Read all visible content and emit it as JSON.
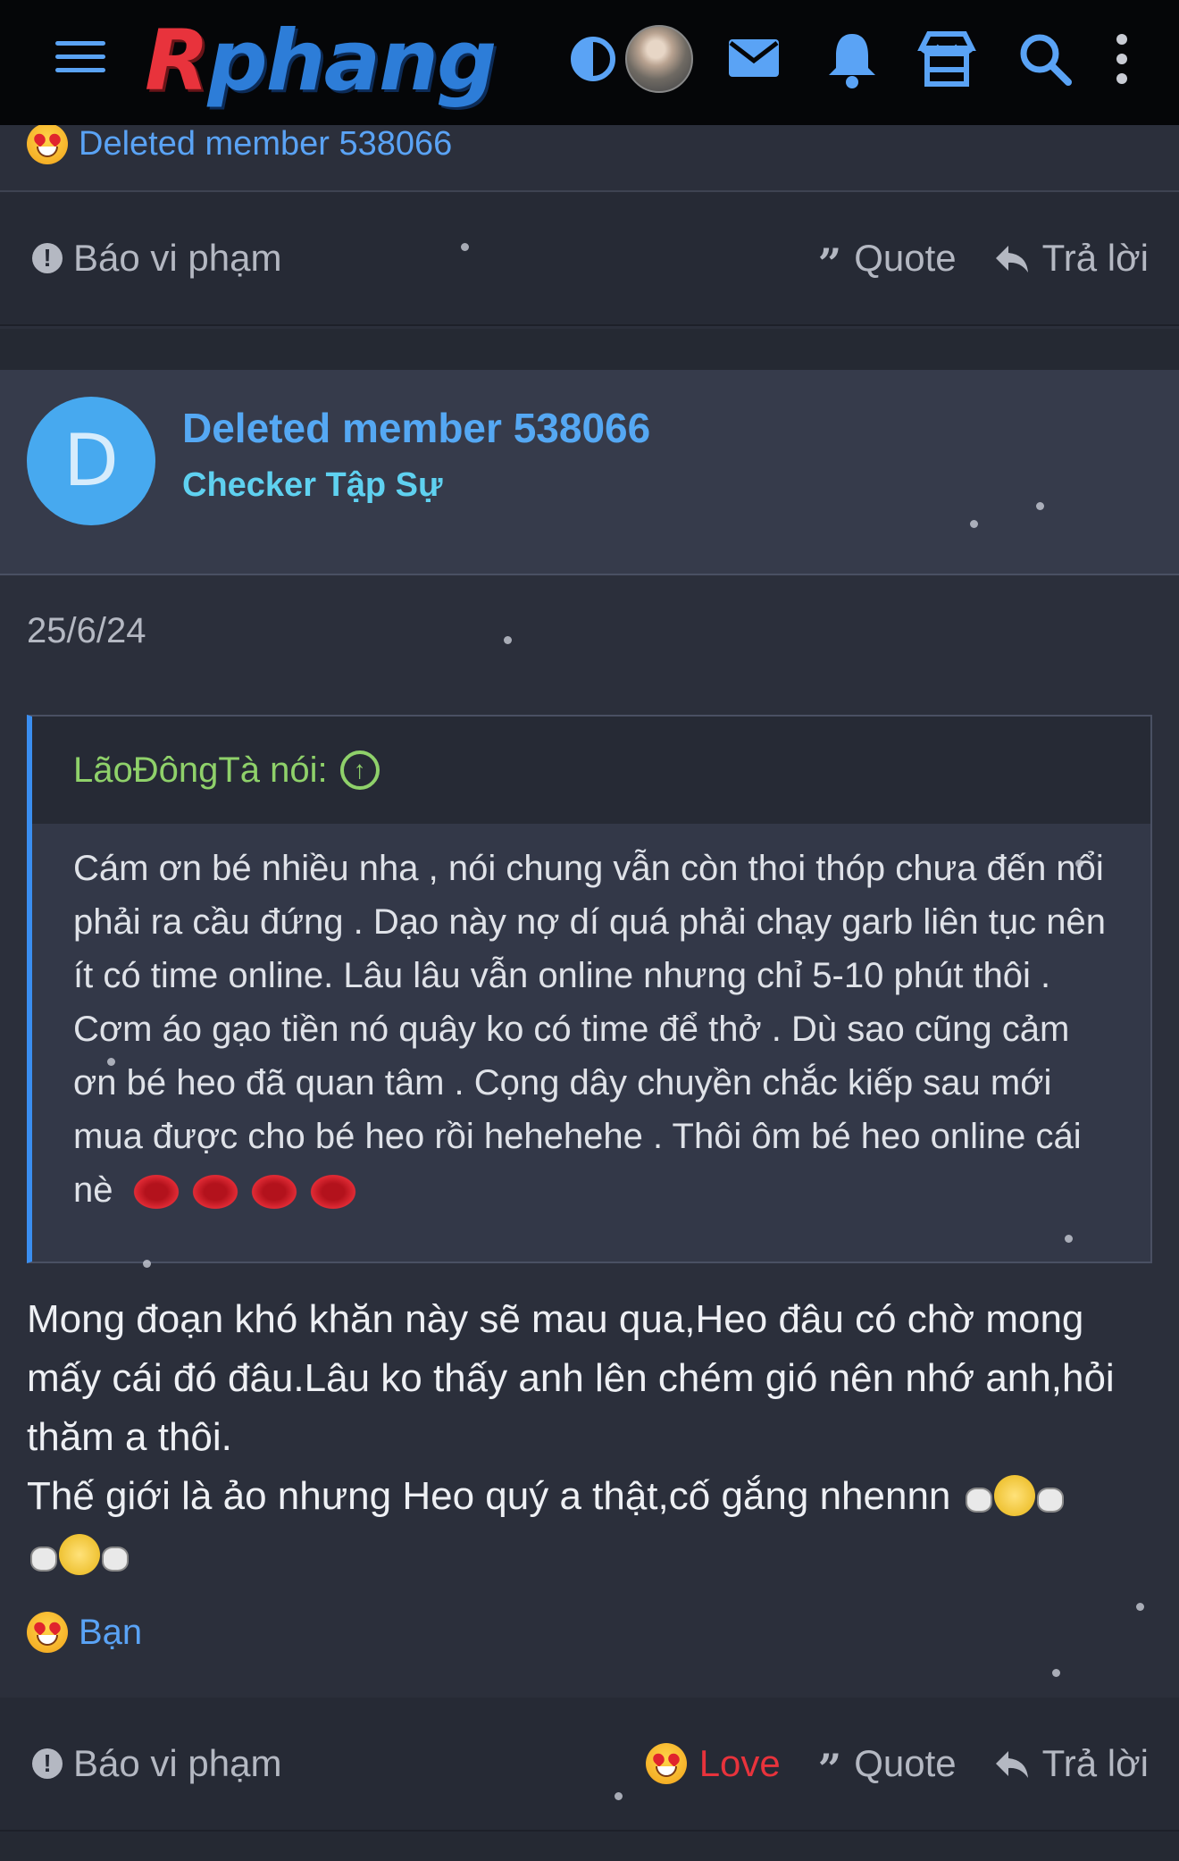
{
  "header": {
    "logo_text": "Rphang",
    "menu_icon": "hamburger-icon",
    "theme_icon": "contrast-icon",
    "mail_icon": "mail-icon",
    "bell_icon": "bell-icon",
    "store_icon": "store-icon",
    "search_icon": "search-icon",
    "more_icon": "more-vertical-icon",
    "accent": "#5aa3f5"
  },
  "prev_post": {
    "reaction_user": "Deleted member 538066",
    "report_label": "Báo vi phạm",
    "quote_label": "Quote",
    "reply_label": "Trả lời"
  },
  "post": {
    "avatar_letter": "D",
    "username": "Deleted member 538066",
    "rank": "Checker Tập Sự",
    "date": "25/6/24",
    "quote": {
      "author_line": "LãoĐôngTà nói:",
      "text": "Cám ơn bé nhiều nha , nói chung vẫn còn thoi thóp chưa đến nổi phải ra cầu đứng . Dạo này nợ dí quá phải chạy garb liên tục nên ít có time online. Lâu lâu vẫn online nhưng chỉ 5-10 phút thôi . Cơm áo gạo tiền nó quây ko có time để thở . Dù sao cũng cảm ơn bé heo đã quan tâm . Cọng dây chuyền chắc kiếp sau mới mua được cho bé heo rồi hehehehe . Thôi ôm bé heo online cái nè"
    },
    "message_line1": "Mong đoạn khó khăn này sẽ mau qua,Heo đâu có chờ mong mấy cái đó đâu.Lâu ko thấy anh lên chém gió nên nhớ anh,hỏi thăm a thôi.",
    "message_line2": "Thế giới là ảo nhưng Heo quý a thật,cố gắng nhennn",
    "reaction_user": "Bạn",
    "report_label": "Báo vi phạm",
    "love_label": "Love",
    "quote_label": "Quote",
    "reply_label": "Trả lời"
  }
}
